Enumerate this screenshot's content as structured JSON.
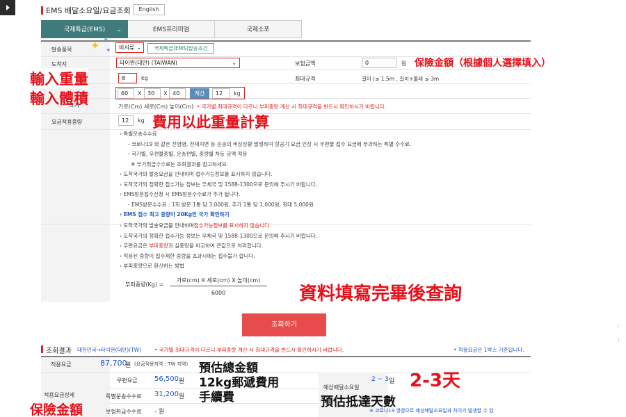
{
  "header": {
    "title": "EMS 배달소요일/요금조회",
    "english_button": "English"
  },
  "tabs": [
    {
      "label": "국제특급(EMS)",
      "active": true
    },
    {
      "label": "EMS프리미엄",
      "active": false
    },
    {
      "label": "국제소포",
      "active": false
    }
  ],
  "form": {
    "item_label": "발송품목",
    "item_value": "비서류",
    "item_condition_button": "국제특급(EMS)발송조건",
    "destination_label": "도착지",
    "destination_value": "타이완(대만) (TAIWAN)",
    "insurance_label": "보험금액",
    "insurance_value": "0",
    "insurance_unit": "원",
    "weight_value": "8",
    "weight_unit": "kg",
    "size_limit_label": "최대규격",
    "size_limit_text": "길이 (≤ 1.5m , 길이+둘레 ≤ 3m",
    "dim_w": "60",
    "dim_x1": "X",
    "dim_l": "30",
    "dim_x2": "X",
    "dim_h": "40",
    "calc_button": "계산",
    "vol_weight": "12",
    "vol_unit": "kg",
    "dims_hint": "가로(Cm) 세로(Cm) 높이(Cm)",
    "dims_warning": "• 국가별 최대규격이 다르니 부피중량 계산 시 최대규격을 반드시 확인하시기 바랍니다.",
    "applied_weight_label": "요금적용중량",
    "applied_weight_value": "12",
    "applied_weight_unit": "kg"
  },
  "notes1": [
    "특별운송수수료",
    "- 코로나19 와 같은 전염병, 천재지변 등 운송의 비상상황 발생하여 항공기 요금 인상 시 우편물 접수 요금에 부과하는 특별 수수료.",
    "- 국가별, 우편물종별, 운송편별, 중량별 차등 금액 적용",
    "※ 부가취급수수료는 조회결과를 참고하세요.",
    "도착국가의 발송요금을 안내하며 접수가능정보를 표시하지 않습니다.",
    "도착국가의 정확한 접수가능 정보는 우체국 및 1588-1300으로 문의해 주시기 바랍니다.",
    "EMS방문접수신청 시 EMS방문수수료가 추가 됩니다.",
    "- EMS방문수수료 : 1회 방문 1통 당 3,000원, 추가 1통 당 1,000원, 최대 5,000원",
    "EMS 접수 최고 중량이 20Kg인 국가 확인하기"
  ],
  "notes2": {
    "line1_a": "도착국가의 발송요금을 안내하며",
    "line1_b": "접수가능정보를 표시하지 않습니다.",
    "line2": "도착국가의 정확한 접수가능 정보는 우체국 및 1588-1300으로 문의해 주시기 바랍니다.",
    "line3_a": "우편요금은",
    "line3_b": "부피중량",
    "line3_c": "과 실중량을 비교하여 큰값으로 처리합니다.",
    "line4": "적용된 중량이 접수제한 중량을 초과시에는 접수불가 합니다.",
    "line5": "부피중량으로 환산하는 방법",
    "formula_label": "부피중량(Kg) =",
    "formula_top": "가로(cm) X 세로(cm) X 높이(cm)",
    "formula_bottom": "6000"
  },
  "submit_button": "조회하기",
  "result": {
    "title": "조회결과",
    "route": "대한민국→타이완(대만)(TW)",
    "warning": "• 국가별 최대규격이 다르니 부피중량 계산 시 최대규격을 반드시 확인하시기 바랍니다.",
    "basis": "• 적용요금은 1박스 기준입니다.",
    "fee_label": "적용요금",
    "fee_value": "87,700",
    "fee_unit": "원",
    "fee_note": "(요금적용지역 : TW 지역)",
    "detail_label": "적용요금상세",
    "postage_label": "우편요금",
    "postage_value": "56,500",
    "postage_unit": "원",
    "special_label": "특별운송수수료",
    "special_value": "31,200",
    "special_unit": "원",
    "insurance_label": "보험취급수수료",
    "insurance_value": "- 원",
    "days_label": "예상배달소요일",
    "days_value": "2 ~ 3",
    "days_unit": "일",
    "covid_note": "※ 코로나19 영향으로 예상배달소요일과 차이가 발생할 수 있"
  },
  "annotations": {
    "insurance": "保險金額（根據個人選擇填入）",
    "weight": "輸入重量",
    "volume": "輸入體積",
    "fee_basis": "費用以此重量計算",
    "fill_then_query": "資料填寫完畢後查詢",
    "estimate_total": "預估總金額",
    "postage_12kg": "12kg郵遞費用",
    "handling_fee": "手續費",
    "days_big": "2-3天",
    "days_estimate": "預估抵達天數",
    "insurance_bottom": "保險金額"
  }
}
